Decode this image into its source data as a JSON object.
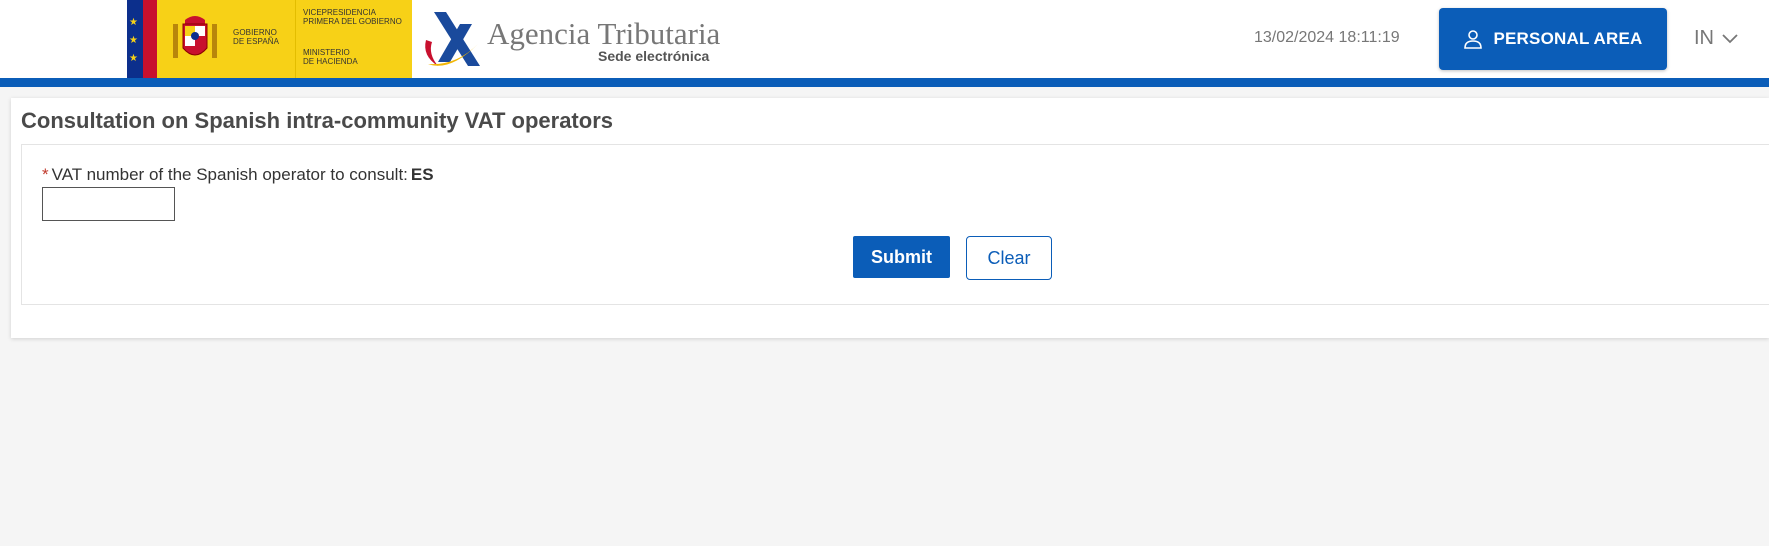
{
  "header": {
    "gov_line1": "GOBIERNO",
    "gov_line2": "DE ESPAÑA",
    "vice_line1": "VICEPRESIDENCIA",
    "vice_line2": "PRIMERA DEL GOBIERNO",
    "min_line1": "MINISTERIO",
    "min_line2": "DE HACIENDA",
    "agency_name": "Agencia Tributaria",
    "agency_sub": "Sede electrónica",
    "datetime": "13/02/2024 18:11:19",
    "personal_area_label": "PERSONAL AREA",
    "language": "IN",
    "brand_color": "#0b5db8"
  },
  "form": {
    "title": "Consultation on Spanish intra-community VAT operators",
    "required_mark": "*",
    "vat_label": "VAT number of the Spanish operator to consult:",
    "vat_prefix": "ES",
    "vat_value": "",
    "submit_label": "Submit",
    "clear_label": "Clear"
  }
}
